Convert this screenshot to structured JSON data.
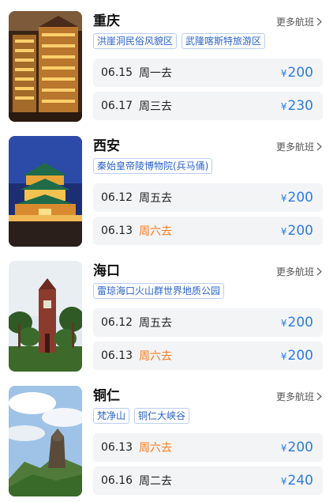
{
  "more_label": "更多航班",
  "currency": "¥",
  "colors": {
    "price": "#2a7de1",
    "weekend": "#ff7a1a",
    "tag": "#2a63c9"
  },
  "destinations": [
    {
      "city": "重庆",
      "tags": [
        "洪崖洞民俗风貌区",
        "武隆喀斯特旅游区"
      ],
      "flights": [
        {
          "date": "06.15",
          "dow": "周一去",
          "weekend": false,
          "price": "200"
        },
        {
          "date": "06.17",
          "dow": "周三去",
          "weekend": false,
          "price": "230"
        }
      ]
    },
    {
      "city": "西安",
      "tags": [
        "秦始皇帝陵博物院(兵马俑)"
      ],
      "flights": [
        {
          "date": "06.12",
          "dow": "周五去",
          "weekend": false,
          "price": "200"
        },
        {
          "date": "06.13",
          "dow": "周六去",
          "weekend": true,
          "price": "200"
        }
      ]
    },
    {
      "city": "海口",
      "tags": [
        "雷琼海口火山群世界地质公园"
      ],
      "flights": [
        {
          "date": "06.12",
          "dow": "周五去",
          "weekend": false,
          "price": "200"
        },
        {
          "date": "06.13",
          "dow": "周六去",
          "weekend": true,
          "price": "200"
        }
      ]
    },
    {
      "city": "铜仁",
      "tags": [
        "梵净山",
        "铜仁大峡谷"
      ],
      "flights": [
        {
          "date": "06.13",
          "dow": "周六去",
          "weekend": true,
          "price": "200"
        },
        {
          "date": "06.16",
          "dow": "周二去",
          "weekend": false,
          "price": "240"
        }
      ]
    }
  ]
}
